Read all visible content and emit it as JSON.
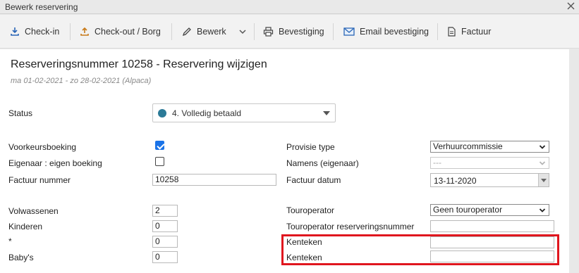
{
  "window": {
    "title": "Bewerk reservering"
  },
  "toolbar": {
    "checkin": "Check-in",
    "checkout": "Check-out / Borg",
    "bewerk": "Bewerk",
    "bevestiging": "Bevestiging",
    "email": "Email bevestiging",
    "factuur": "Factuur"
  },
  "header": {
    "title": "Reserveringsnummer 10258 - Reservering wijzigen",
    "subtitle": "ma 01-02-2021 - zo 28-02-2021 (Alpaca)"
  },
  "form": {
    "status_label": "Status",
    "status_value": "4. Volledig betaald",
    "status_color": "#2b7a97",
    "voorkeur_label": "Voorkeursboeking",
    "voorkeur_checked": true,
    "eigenaar_label": "Eigenaar : eigen boeking",
    "eigenaar_checked": false,
    "factuurnr_label": "Factuur nummer",
    "factuurnr_value": "10258",
    "volwassenen_label": "Volwassenen",
    "volwassenen_value": "2",
    "kinderen_label": "Kinderen",
    "kinderen_value": "0",
    "star_label": "*",
    "star_value": "0",
    "babys_label": "Baby's",
    "babys_value": "0",
    "provisie_label": "Provisie type",
    "provisie_value": "Verhuurcommissie",
    "namens_label": "Namens (eigenaar)",
    "namens_value": "---",
    "factuurdatum_label": "Factuur datum",
    "factuurdatum_value": "13-11-2020",
    "touroperator_label": "Touroperator",
    "touroperator_value": "Geen touroperator",
    "tour_resnr_label": "Touroperator reserveringsnummer",
    "tour_resnr_value": "",
    "kenteken1_label": "Kenteken",
    "kenteken1_value": "",
    "kenteken2_label": "Kenteken",
    "kenteken2_value": ""
  },
  "colors": {
    "highlight": "#e0161e",
    "checkbox": "#1a73e8"
  }
}
